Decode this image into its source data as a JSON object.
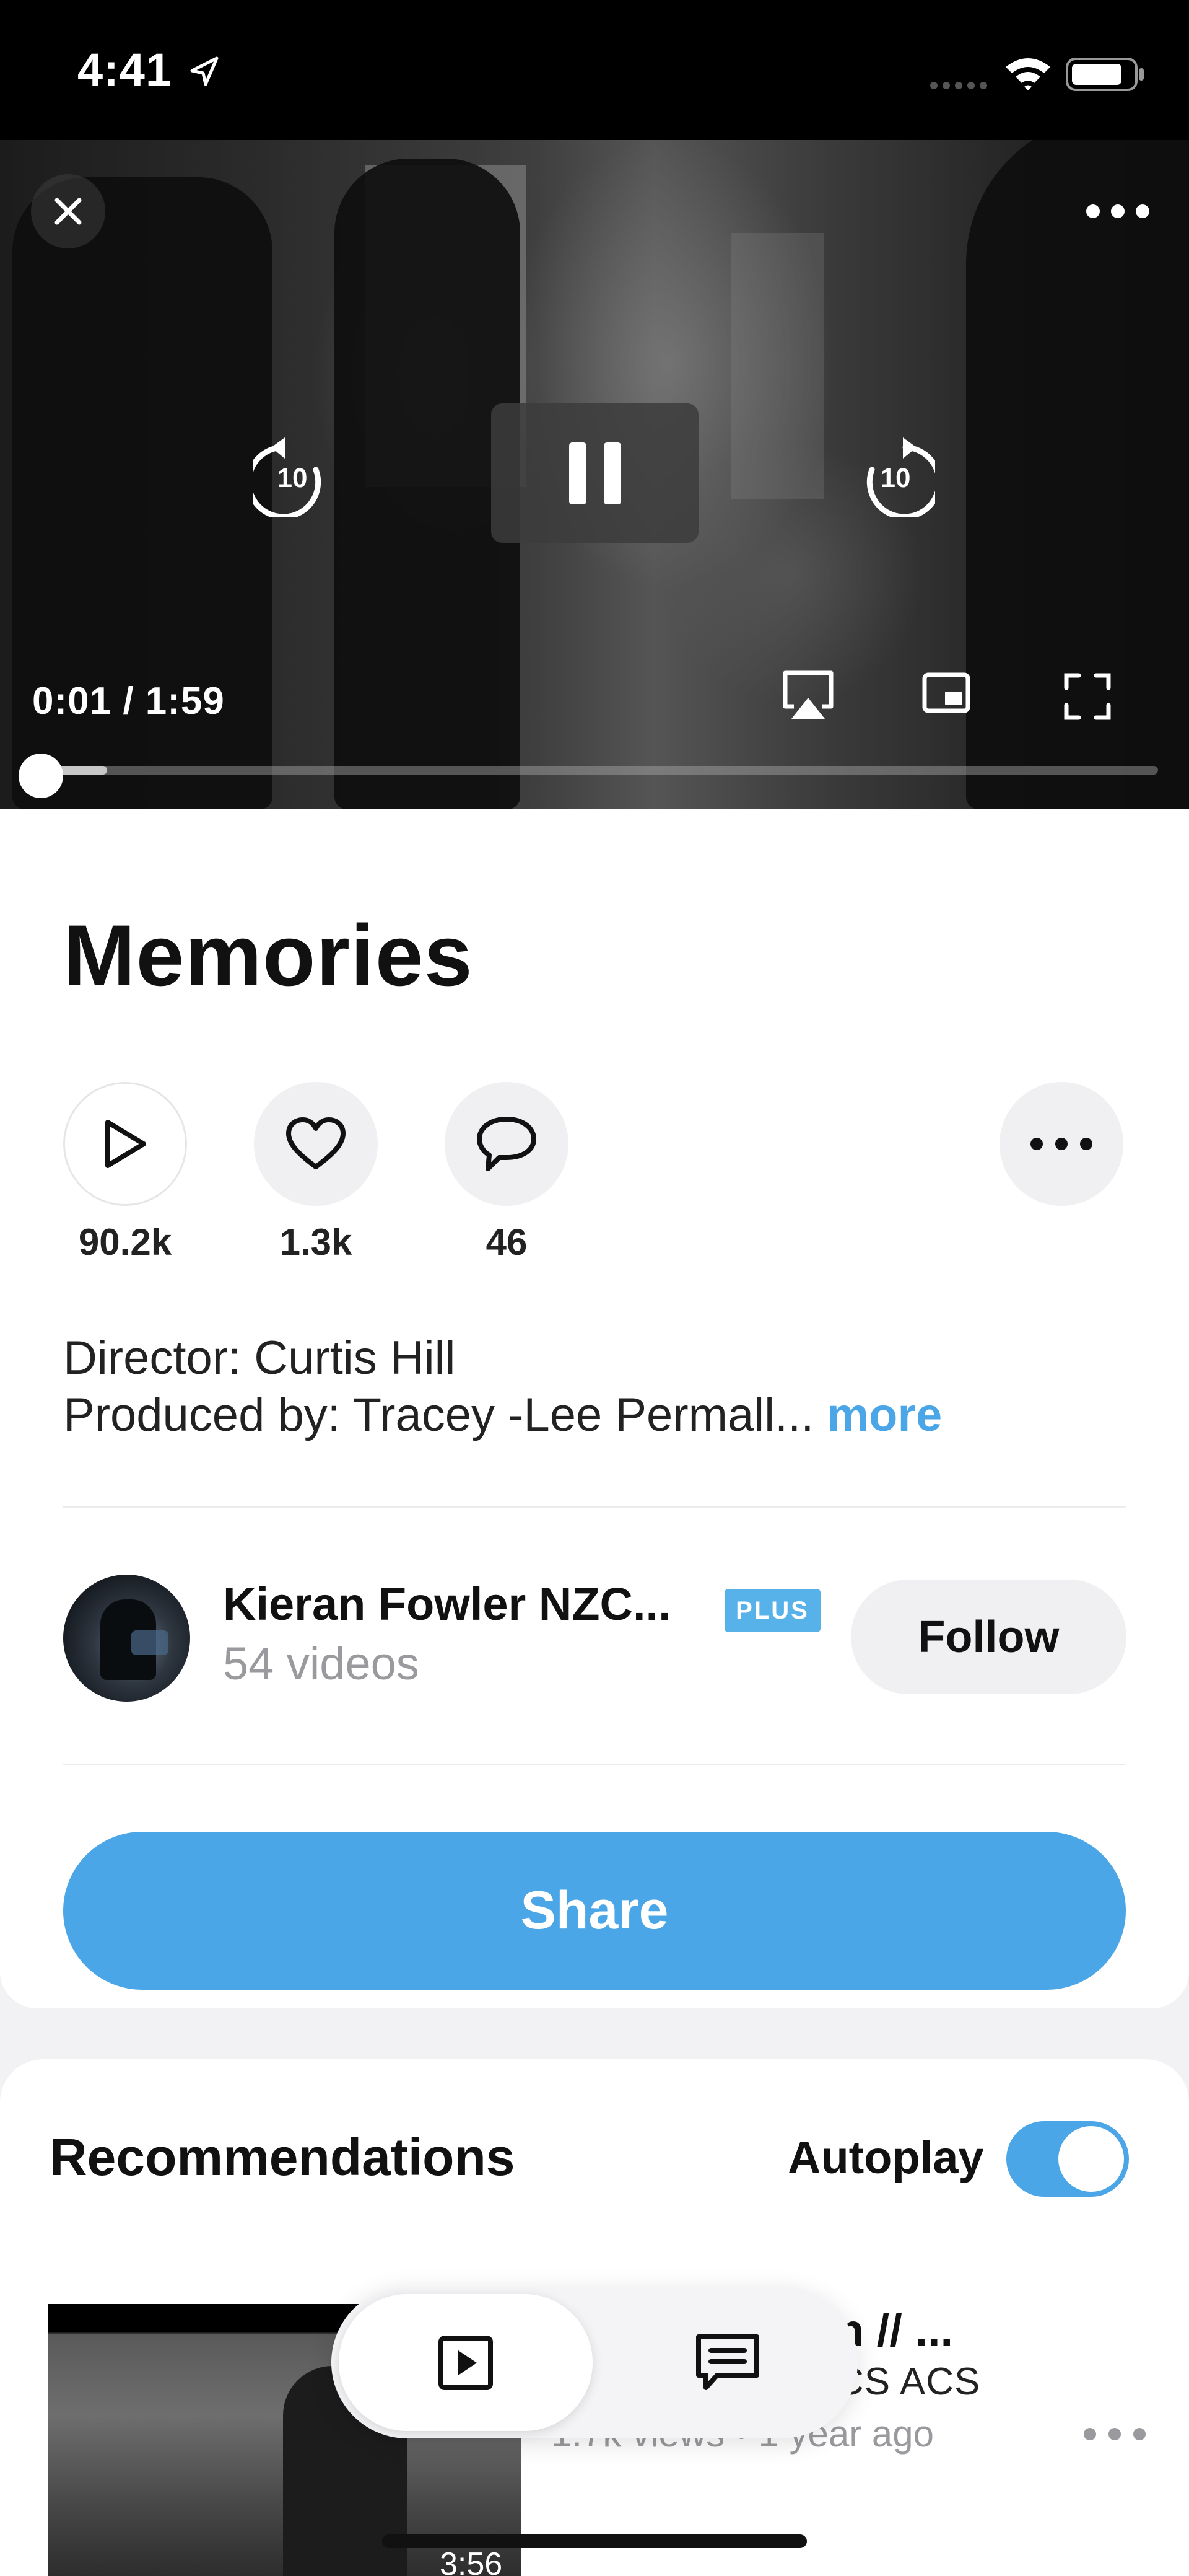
{
  "status_bar": {
    "time": "4:41"
  },
  "player": {
    "time_readout": "0:01 / 1:59",
    "progress": 0.06,
    "rewind_seconds": "10",
    "forward_seconds": "10"
  },
  "video": {
    "title": "Memories",
    "stats": [
      {
        "icon": "play-icon",
        "count": "90.2k"
      },
      {
        "icon": "heart-icon",
        "count": "1.3k"
      },
      {
        "icon": "comment-icon",
        "count": "46"
      }
    ],
    "description_line1": "Director: Curtis Hill",
    "description_line2": "Produced by: Tracey -Lee Permall...",
    "more_label": "more"
  },
  "channel": {
    "name": "Kieran Fowler NZC...",
    "badge": "PLUS",
    "videos": "54 videos",
    "follow_label": "Follow"
  },
  "share_label": "Share",
  "recommendations": {
    "title": "Recommendations",
    "autoplay_label": "Autoplay",
    "autoplay_on": true,
    "items": [
      {
        "title": "n // ...",
        "channel": "CS ACS",
        "meta": "1.7k views • 1 year ago",
        "duration": "3:56"
      }
    ]
  },
  "tabs": {
    "video_icon": "video-tab-icon",
    "comments_icon": "comments-tab-icon"
  },
  "colors": {
    "accent": "#4aa6e6",
    "badge": "#58b2ea"
  }
}
